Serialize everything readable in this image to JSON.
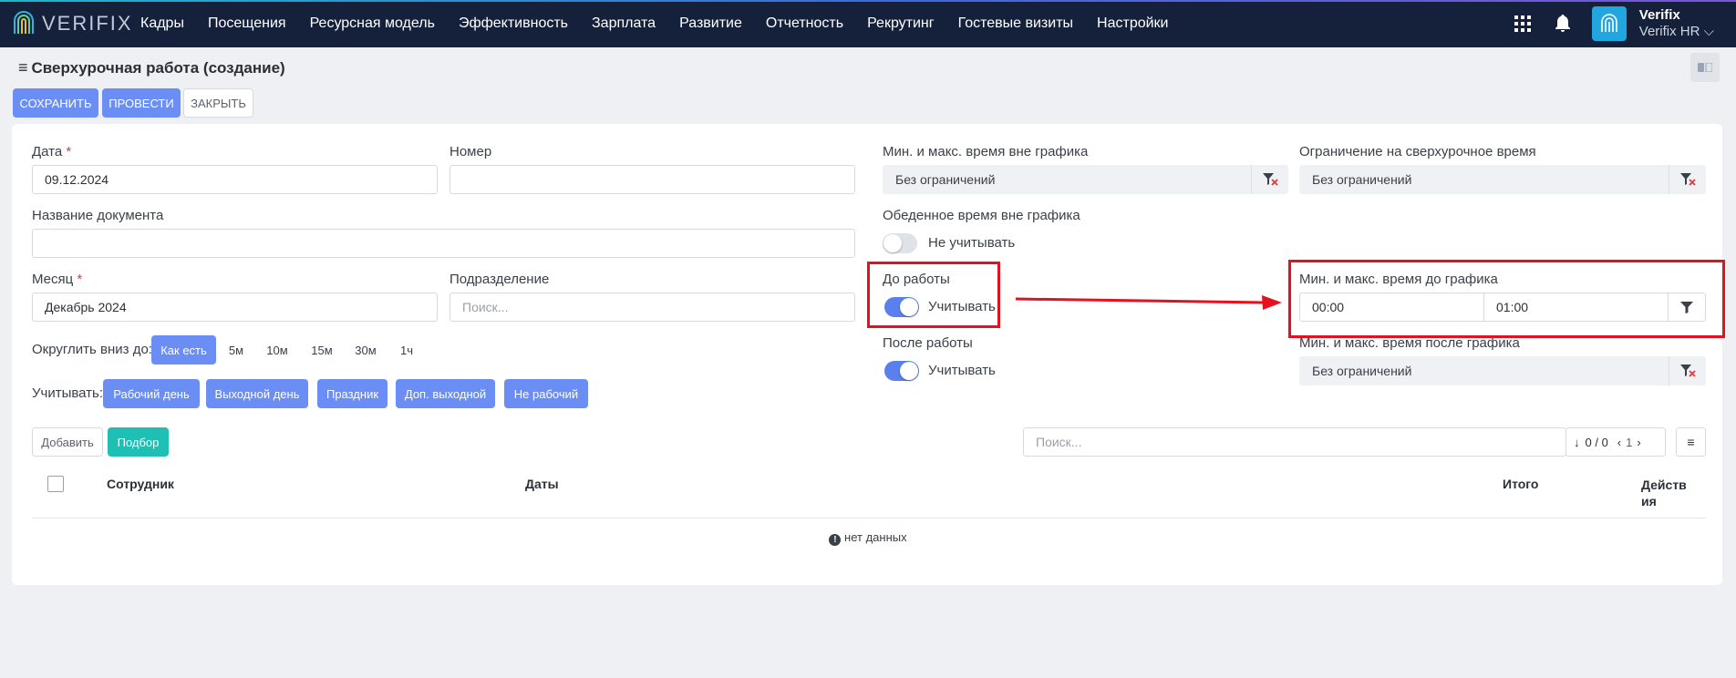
{
  "nav": {
    "logo_text": "VERIFIX",
    "items": [
      "Кадры",
      "Посещения",
      "Ресурсная модель",
      "Эффективность",
      "Зарплата",
      "Развитие",
      "Отчетность",
      "Рекрутинг",
      "Гостевые визиты",
      "Настройки"
    ],
    "user_name": "Verifix",
    "user_org": "Verifix HR"
  },
  "page": {
    "title": "Сверхурочная работа (создание)"
  },
  "toolbar": {
    "save": "СОХРАНИТЬ",
    "post": "ПРОВЕСТИ",
    "close": "ЗАКРЫТЬ"
  },
  "form": {
    "date_label": "Дата",
    "date_value": "09.12.2024",
    "number_label": "Номер",
    "number_value": "",
    "docname_label": "Название документа",
    "docname_value": "",
    "month_label": "Месяц",
    "month_value": "Декабрь 2024",
    "division_label": "Подразделение",
    "division_placeholder": "Поиск...",
    "required_mark": "*",
    "round_label": "Округлить вниз до:",
    "round_options": [
      "Как есть",
      "5м",
      "10м",
      "15м",
      "30м",
      "1ч"
    ],
    "round_selected": "Как есть",
    "consider_label": "Учитывать:",
    "consider_options": [
      "Рабочий день",
      "Выходной день",
      "Праздник",
      "Доп. выходной",
      "Не рабочий"
    ]
  },
  "right": {
    "offschedule_label": "Мин. и макс. время вне графика",
    "offschedule_value": "Без ограничений",
    "limit_label": "Ограничение на сверхурочное время",
    "limit_value": "Без ограничений",
    "lunch_label": "Обеденное время вне графика",
    "lunch_toggle_text": "Не учитывать",
    "lunch_on": false,
    "before_label": "До работы",
    "before_toggle_text": "Учитывать",
    "before_on": true,
    "before_range_label": "Мин. и макс. время до графика",
    "before_min": "00:00",
    "before_max": "01:00",
    "after_label": "После работы",
    "after_toggle_text": "Учитывать",
    "after_on": true,
    "after_range_label": "Мин. и макс. время после графика",
    "after_value": "Без ограничений"
  },
  "table": {
    "add_btn": "Добавить",
    "pick_btn": "Подбор",
    "search_placeholder": "Поиск...",
    "count": "0 / 0",
    "page": "1",
    "col_employee": "Сотрудник",
    "col_dates": "Даты",
    "col_total": "Итого",
    "col_actions": "Действия",
    "empty_text": "нет данных"
  },
  "colors": {
    "primary": "#6b8ef5",
    "teal": "#1fbfb4",
    "nav_bg": "#15213a",
    "annotation": "#e8101e"
  }
}
